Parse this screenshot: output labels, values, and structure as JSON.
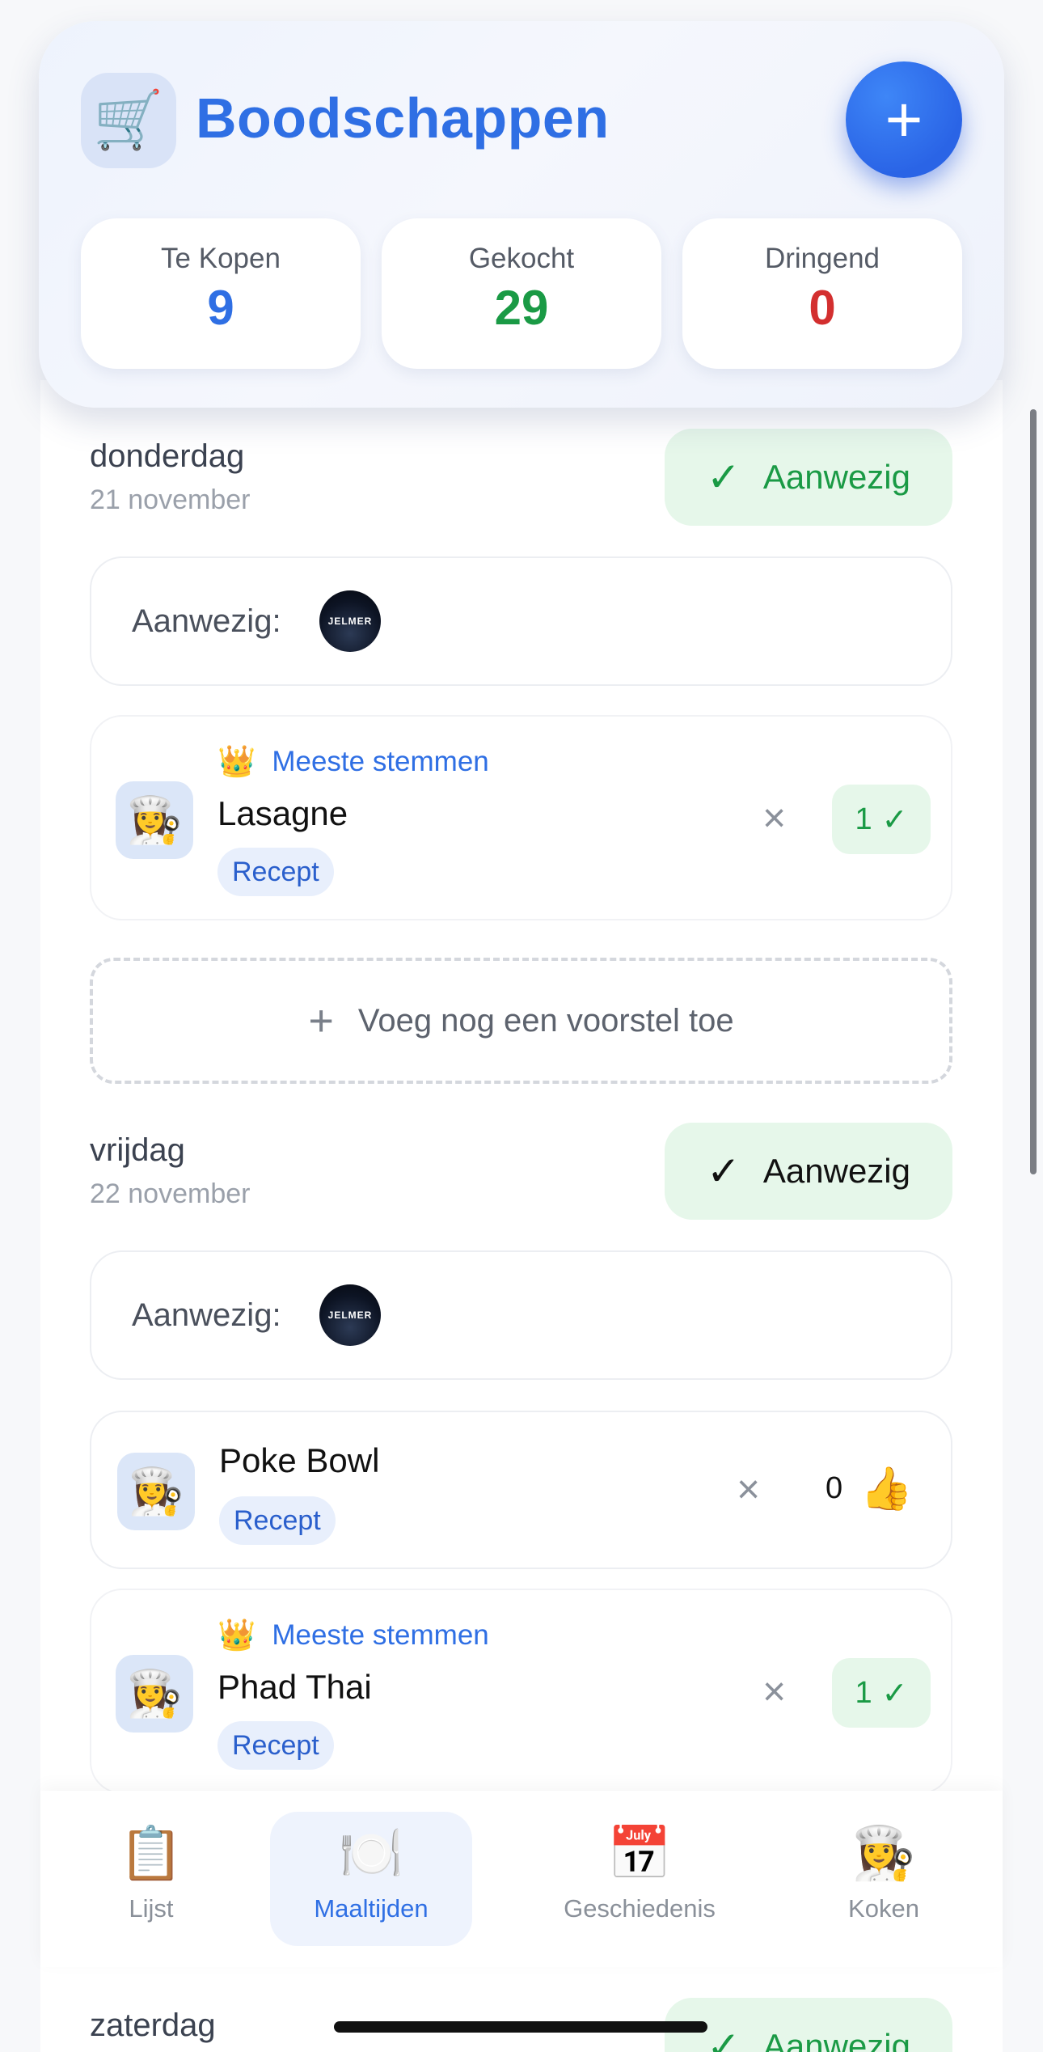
{
  "header": {
    "logo_icon": "🛒",
    "title": "Boodschappen",
    "add_button_icon": "+",
    "stats": [
      {
        "label": "Te Kopen",
        "value": "9",
        "color": "#2f6fe4"
      },
      {
        "label": "Gekocht",
        "value": "29",
        "color": "#1a9a45"
      },
      {
        "label": "Dringend",
        "value": "0",
        "color": "#d32f2f"
      }
    ]
  },
  "days": [
    {
      "name": "donderdag",
      "date": "21 november",
      "present_label": "Aanwezig",
      "present_check": "✓",
      "present_color": "#1a9a45",
      "attendance_label": "Aanwezig:",
      "attendee_avatar": "JELMER",
      "meals": [
        {
          "top_label": "Meeste stemmen",
          "crown": "👑",
          "icon": "👩‍🍳",
          "name": "Lasagne",
          "recipe": "Recept",
          "remove": "×",
          "votes": "1",
          "vote_icon": "✓"
        }
      ],
      "add_proposal": "Voeg nog een voorstel toe",
      "add_icon": "+"
    },
    {
      "name": "vrijdag",
      "date": "22 november",
      "present_label": "Aanwezig",
      "present_check": "✓",
      "present_color": "#111111",
      "attendance_label": "Aanwezig:",
      "attendee_avatar": "JELMER",
      "meals": [
        {
          "icon": "👩‍🍳",
          "name": "Poke Bowl",
          "recipe": "Recept",
          "remove": "×",
          "votes": "0",
          "vote_icon": "👍"
        },
        {
          "top_label": "Meeste stemmen",
          "crown": "👑",
          "icon": "👩‍🍳",
          "name": "Phad Thai",
          "recipe": "Recept",
          "remove": "×",
          "votes": "1",
          "vote_icon": "✓"
        }
      ]
    },
    {
      "name": "zaterdag",
      "present_label": "Aanwezig",
      "present_check": "✓",
      "present_color": "#1a9a45"
    }
  ],
  "tabs": [
    {
      "icon": "📋",
      "label": "Lijst",
      "active": false
    },
    {
      "icon": "🍽️",
      "label": "Maaltijden",
      "active": true
    },
    {
      "icon": "📅",
      "label": "Geschiedenis",
      "active": false
    },
    {
      "icon": "👩‍🍳",
      "label": "Koken",
      "active": false
    }
  ]
}
